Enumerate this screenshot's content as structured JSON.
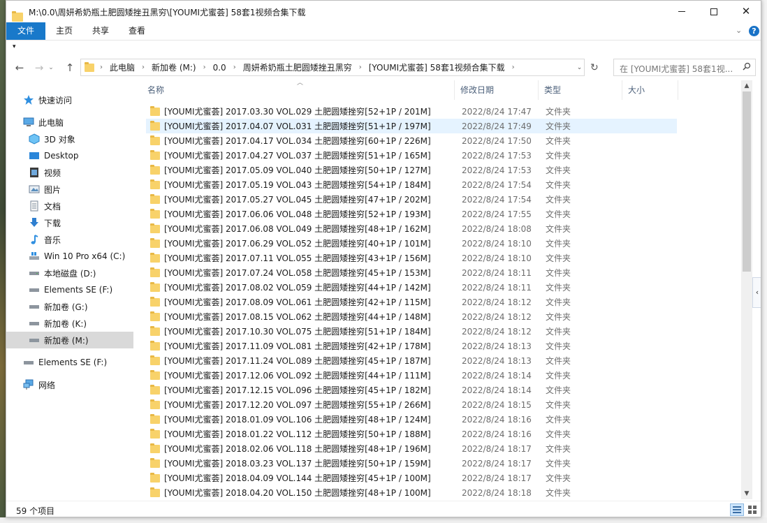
{
  "window": {
    "title": "M:\\0.0\\周妍希奶瓶土肥圆矮挫丑黑穷\\[YOUMI尤蜜荟] 58套1视频合集下载"
  },
  "ribbon": {
    "tabs": [
      "文件",
      "主页",
      "共享",
      "查看"
    ]
  },
  "address": {
    "crumbs": [
      "此电脑",
      "新加卷 (M:)",
      "0.0",
      "周妍希奶瓶土肥圆矮挫丑黑穷",
      "[YOUMI尤蜜荟] 58套1视频合集下载"
    ]
  },
  "search": {
    "placeholder": "在 [YOUMI尤蜜荟] 58套1视..."
  },
  "navpane": {
    "items": [
      {
        "label": "快速访问",
        "icon": "star-icon"
      },
      {
        "label": "此电脑",
        "icon": "computer-icon"
      },
      {
        "label": "3D 对象",
        "icon": "cube-icon"
      },
      {
        "label": "Desktop",
        "icon": "desktop-icon"
      },
      {
        "label": "视频",
        "icon": "video-icon"
      },
      {
        "label": "图片",
        "icon": "pictures-icon"
      },
      {
        "label": "文档",
        "icon": "documents-icon"
      },
      {
        "label": "下载",
        "icon": "download-icon"
      },
      {
        "label": "音乐",
        "icon": "music-icon"
      },
      {
        "label": "Win 10 Pro x64 (C:)",
        "icon": "windows-drive-icon"
      },
      {
        "label": "本地磁盘 (D:)",
        "icon": "drive-icon"
      },
      {
        "label": "Elements SE (F:)",
        "icon": "drive-icon"
      },
      {
        "label": "新加卷 (G:)",
        "icon": "drive-icon"
      },
      {
        "label": "新加卷 (K:)",
        "icon": "drive-icon"
      },
      {
        "label": "新加卷 (M:)",
        "icon": "drive-icon"
      },
      {
        "label": "Elements SE (F:)",
        "icon": "drive-icon"
      },
      {
        "label": "网络",
        "icon": "network-icon"
      }
    ]
  },
  "columns": {
    "name": "名称",
    "date": "修改日期",
    "type": "类型",
    "size": "大小"
  },
  "files": [
    {
      "name": "[YOUMI尤蜜荟] 2017.03.30 VOL.029 土肥圆矮挫穷[52+1P / 201M]",
      "date": "2022/8/24 17:47",
      "type": "文件夹"
    },
    {
      "name": "[YOUMI尤蜜荟] 2017.04.07 VOL.031 土肥圆矮挫穷[51+1P / 197M]",
      "date": "2022/8/24 17:49",
      "type": "文件夹"
    },
    {
      "name": "[YOUMI尤蜜荟] 2017.04.17 VOL.034 土肥圆矮挫穷[60+1P / 226M]",
      "date": "2022/8/24 17:50",
      "type": "文件夹"
    },
    {
      "name": "[YOUMI尤蜜荟] 2017.04.27 VOL.037 土肥圆矮挫穷[51+1P / 165M]",
      "date": "2022/8/24 17:53",
      "type": "文件夹"
    },
    {
      "name": "[YOUMI尤蜜荟] 2017.05.09 VOL.040 土肥圆矮挫穷[50+1P / 127M]",
      "date": "2022/8/24 17:53",
      "type": "文件夹"
    },
    {
      "name": "[YOUMI尤蜜荟] 2017.05.19 VOL.043 土肥圆矮挫穷[54+1P / 184M]",
      "date": "2022/8/24 17:54",
      "type": "文件夹"
    },
    {
      "name": "[YOUMI尤蜜荟] 2017.05.27 VOL.045 土肥圆矮挫穷[47+1P / 202M]",
      "date": "2022/8/24 17:54",
      "type": "文件夹"
    },
    {
      "name": "[YOUMI尤蜜荟] 2017.06.06 VOL.048 土肥圆矮挫穷[52+1P / 193M]",
      "date": "2022/8/24 17:55",
      "type": "文件夹"
    },
    {
      "name": "[YOUMI尤蜜荟] 2017.06.08 VOL.049 土肥圆矮挫穷[48+1P / 162M]",
      "date": "2022/8/24 18:08",
      "type": "文件夹"
    },
    {
      "name": "[YOUMI尤蜜荟] 2017.06.29 VOL.052 土肥圆矮挫穷[40+1P / 101M]",
      "date": "2022/8/24 18:10",
      "type": "文件夹"
    },
    {
      "name": "[YOUMI尤蜜荟] 2017.07.11 VOL.055 土肥圆矮挫穷[43+1P / 156M]",
      "date": "2022/8/24 18:10",
      "type": "文件夹"
    },
    {
      "name": "[YOUMI尤蜜荟] 2017.07.24 VOL.058 土肥圆矮挫穷[45+1P / 153M]",
      "date": "2022/8/24 18:11",
      "type": "文件夹"
    },
    {
      "name": "[YOUMI尤蜜荟] 2017.08.02 VOL.059 土肥圆矮挫穷[44+1P / 142M]",
      "date": "2022/8/24 18:11",
      "type": "文件夹"
    },
    {
      "name": "[YOUMI尤蜜荟] 2017.08.09 VOL.061 土肥圆矮挫穷[42+1P / 115M]",
      "date": "2022/8/24 18:12",
      "type": "文件夹"
    },
    {
      "name": "[YOUMI尤蜜荟] 2017.08.15 VOL.062 土肥圆矮挫穷[44+1P / 148M]",
      "date": "2022/8/24 18:12",
      "type": "文件夹"
    },
    {
      "name": "[YOUMI尤蜜荟] 2017.10.30 VOL.075 土肥圆矮挫穷[51+1P / 184M]",
      "date": "2022/8/24 18:12",
      "type": "文件夹"
    },
    {
      "name": "[YOUMI尤蜜荟] 2017.11.09 VOL.081 土肥圆矮挫穷[42+1P / 178M]",
      "date": "2022/8/24 18:13",
      "type": "文件夹"
    },
    {
      "name": "[YOUMI尤蜜荟] 2017.11.24 VOL.089 土肥圆矮挫穷[45+1P / 187M]",
      "date": "2022/8/24 18:13",
      "type": "文件夹"
    },
    {
      "name": "[YOUMI尤蜜荟] 2017.12.06 VOL.092 土肥圆矮挫穷[44+1P / 111M]",
      "date": "2022/8/24 18:14",
      "type": "文件夹"
    },
    {
      "name": "[YOUMI尤蜜荟] 2017.12.15 VOL.096 土肥圆矮挫穷[45+1P / 182M]",
      "date": "2022/8/24 18:14",
      "type": "文件夹"
    },
    {
      "name": "[YOUMI尤蜜荟] 2017.12.20 VOL.097 土肥圆矮挫穷[55+1P / 266M]",
      "date": "2022/8/24 18:15",
      "type": "文件夹"
    },
    {
      "name": "[YOUMI尤蜜荟] 2018.01.09 VOL.106 土肥圆矮挫穷[48+1P / 124M]",
      "date": "2022/8/24 18:16",
      "type": "文件夹"
    },
    {
      "name": "[YOUMI尤蜜荟] 2018.01.22 VOL.112 土肥圆矮挫穷[50+1P / 188M]",
      "date": "2022/8/24 18:16",
      "type": "文件夹"
    },
    {
      "name": "[YOUMI尤蜜荟] 2018.02.06 VOL.118 土肥圆矮挫穷[48+1P / 196M]",
      "date": "2022/8/24 18:17",
      "type": "文件夹"
    },
    {
      "name": "[YOUMI尤蜜荟] 2018.03.23 VOL.137 土肥圆矮挫穷[50+1P / 159M]",
      "date": "2022/8/24 18:17",
      "type": "文件夹"
    },
    {
      "name": "[YOUMI尤蜜荟] 2018.04.09 VOL.144 土肥圆矮挫穷[45+1P / 100M]",
      "date": "2022/8/24 18:17",
      "type": "文件夹"
    },
    {
      "name": "[YOUMI尤蜜荟] 2018.04.20 VOL.150 土肥圆矮挫穷[48+1P / 100M]",
      "date": "2022/8/24 18:18",
      "type": "文件夹"
    }
  ],
  "status": {
    "count": "59 个项目"
  },
  "colors": {
    "accent": "#1979ca",
    "folder": "#f8d26a",
    "hover_row": "#e5f3ff",
    "selected_nav": "#d9d9d9"
  }
}
